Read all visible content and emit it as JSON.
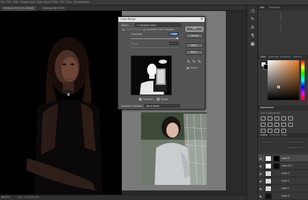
{
  "app": {
    "menu_items": [
      "Ps",
      "File",
      "Edit",
      "Image",
      "Layer",
      "Type",
      "Select",
      "Filter",
      "3D",
      "View",
      "Window",
      "Help"
    ],
    "doc_tabs": [
      {
        "label": "Untitled-1 @ 66.7% (RGB/8)"
      },
      {
        "label": "Untitled-2 @ 33.3%"
      }
    ],
    "status_left": "66.67%",
    "status_mid": "Doc: 7.20M/19.8M"
  },
  "dialog": {
    "title": "Color Range",
    "select_label": "Select:",
    "select_value": "Sampled Colors",
    "detect_faces": "Detect Faces",
    "localized": "Localized Color Clusters",
    "fuzziness_label": "Fuzziness:",
    "fuzziness_value": "200",
    "range_label": "Range:",
    "radio_selection": "Selection",
    "radio_image": "Image",
    "selection_preview_label": "Selection Preview:",
    "selection_preview_value": "Black Matte",
    "buttons": {
      "ok": "OK",
      "cancel": "Cancel",
      "load": "Load...",
      "save": "Save..."
    },
    "invert_label": "Invert"
  },
  "panels": {
    "info_tabs": [
      "Info",
      "Properties"
    ],
    "color_tabs": [
      "Color",
      "Swatches",
      "Gradients",
      "Patterns"
    ],
    "adjustments_tab": "Adjustments",
    "adjustments_sub": "Add an adjustment",
    "layers_tabs": [
      "Layers",
      "Channels",
      "Paths"
    ],
    "layers": [
      {
        "name": "Layer 4"
      },
      {
        "name": "Color Fill 1"
      },
      {
        "name": "Layer 3"
      },
      {
        "name": "Layer 2"
      },
      {
        "name": "Layer 1"
      },
      {
        "name": "Layer 0"
      }
    ],
    "accent_color": "#3b8be0"
  },
  "colors": {
    "picker_hue": "#e07a2a"
  }
}
